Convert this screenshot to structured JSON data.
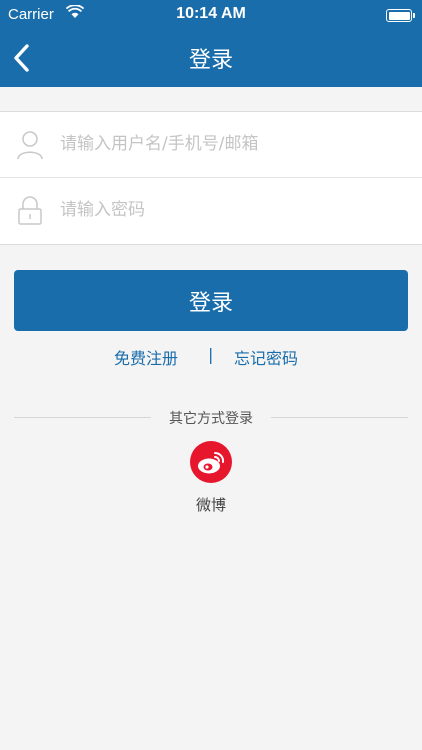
{
  "status_bar": {
    "carrier": "Carrier",
    "time": "10:14 AM",
    "wifi_icon": "wifi-icon",
    "battery_icon": "battery-icon"
  },
  "nav": {
    "title": "登录",
    "back_icon": "chevron-left-icon"
  },
  "form": {
    "username_placeholder": "请输入用户名/手机号/邮箱",
    "username_value": "",
    "password_placeholder": "请输入密码",
    "password_value": "",
    "username_icon": "user-icon",
    "password_icon": "lock-icon"
  },
  "actions": {
    "login_label": "登录",
    "register_label": "免费注册",
    "separator": "|",
    "forgot_label": "忘记密码"
  },
  "other_login": {
    "title": "其它方式登录",
    "weibo_label": "微博",
    "weibo_icon": "weibo-icon"
  },
  "colors": {
    "primary": "#1a6dab",
    "background": "#f4f4f4",
    "weibo_red": "#e6162d",
    "placeholder": "#c4c4c4"
  }
}
